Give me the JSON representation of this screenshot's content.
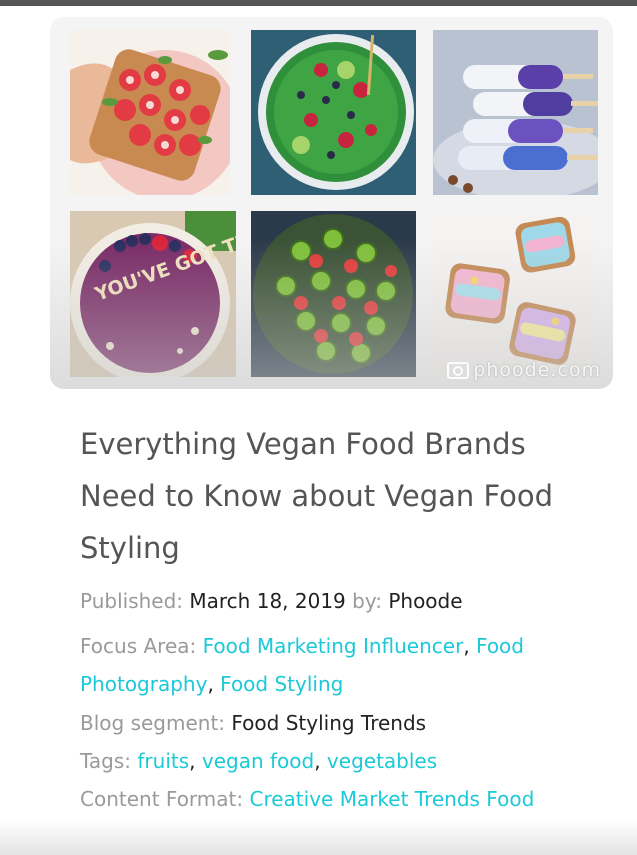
{
  "gallery": {
    "watermark": "phoode.com",
    "tiles": [
      {
        "name": "strawberry-toast-photo"
      },
      {
        "name": "green-smoothie-bowl-photo"
      },
      {
        "name": "popsicles-photo"
      },
      {
        "name": "acai-bowl-photo",
        "text": "YOU'VE GOT THIS"
      },
      {
        "name": "fruit-platter-photo"
      },
      {
        "name": "unicorn-toast-photo"
      }
    ]
  },
  "article": {
    "title": "Everything Vegan Food Brands Need to Know about Vegan Food Styling",
    "published_label": "Published:",
    "published_date": "March 18, 2019",
    "by_label": "by:",
    "author": "Phoode",
    "focus_label": "Focus Area:",
    "focus_areas": [
      "Food Marketing Influencer",
      "Food Photography",
      "Food Styling"
    ],
    "segment_label": "Blog segment:",
    "segment": "Food Styling Trends",
    "tags_label": "Tags:",
    "tags": [
      "fruits",
      "vegan food",
      "vegetables"
    ],
    "format_label": "Content Format:",
    "format": "Creative Market Trends Food"
  },
  "colors": {
    "link": "#1cc9d7",
    "label": "#9a9a9a",
    "title": "#555555",
    "text": "#222222"
  }
}
